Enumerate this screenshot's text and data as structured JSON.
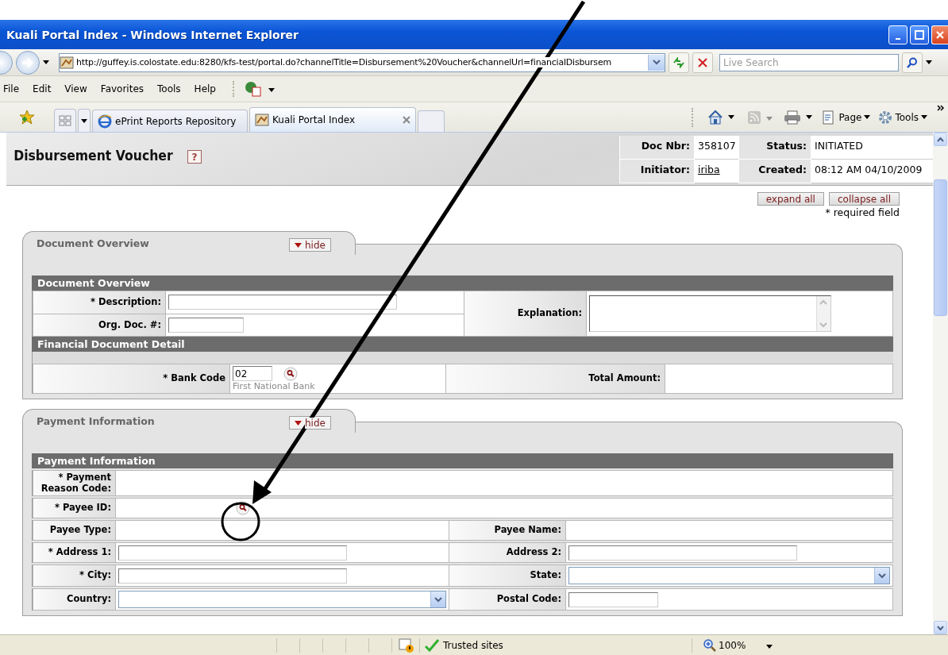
{
  "window": {
    "title": "Kuali Portal Index - Windows Internet Explorer"
  },
  "address_bar": {
    "url": "http://guffey.is.colostate.edu:8280/kfs-test/portal.do?channelTitle=Disbursement%20Voucher&channelUrl=financialDisbursem",
    "search_placeholder": "Live Search"
  },
  "menu": [
    "File",
    "Edit",
    "View",
    "Favorites",
    "Tools",
    "Help"
  ],
  "tabs": [
    {
      "label": "ePrint Reports Repository",
      "selected": false
    },
    {
      "label": "Kuali Portal Index",
      "selected": true
    }
  ],
  "command_bar": [
    "Page",
    "Tools"
  ],
  "page": {
    "title": "Disbursement Voucher",
    "help": "?",
    "doc_info": [
      {
        "label": "Doc Nbr:",
        "value": "358107",
        "kind": "text"
      },
      {
        "label": "Status:",
        "value": "INITIATED",
        "kind": "text"
      },
      {
        "label": "Initiator:",
        "value": "iriba",
        "kind": "link"
      },
      {
        "label": "Created:",
        "value": "08:12 AM 04/10/2009",
        "kind": "text"
      }
    ],
    "buttons": [
      "expand all",
      "collapse all"
    ],
    "required_note": "* required field",
    "sections": [
      {
        "tab_title": "Document Overview",
        "toggle": "hide",
        "subsections": [
          {
            "header": "Document Overview",
            "kind": "overview",
            "fields": [
              {
                "label": "* Description:",
                "kind": "text-long"
              },
              {
                "label": "Org. Doc. #:",
                "kind": "text-short"
              },
              {
                "label": "Explanation:",
                "kind": "textarea"
              }
            ]
          },
          {
            "header": "Financial Document Detail",
            "kind": "detail",
            "fields": [
              {
                "label": "* Bank Code",
                "kind": "text-tiny",
                "value": "02",
                "lookup": true,
                "note": "First National Bank"
              },
              {
                "label": "Total Amount:",
                "kind": "none"
              }
            ]
          }
        ]
      },
      {
        "tab_title": "Payment Information",
        "toggle": "hide",
        "subsections": [
          {
            "header": "Payment Information",
            "kind": "payment",
            "rows": [
              {
                "kind": "wide",
                "fields": [
                  {
                    "label": "* Payment Reason Code:",
                    "kind": "none"
                  }
                ]
              },
              {
                "kind": "wide",
                "fields": [
                  {
                    "label": "* Payee ID:",
                    "kind": "none",
                    "lookup": true
                  }
                ]
              },
              {
                "kind": "pair",
                "fields": [
                  {
                    "label": "Payee Type:",
                    "kind": "none"
                  },
                  {
                    "label": "Payee Name:",
                    "kind": "none"
                  }
                ]
              },
              {
                "kind": "pair",
                "fields": [
                  {
                    "label": "* Address 1:",
                    "kind": "text-long"
                  },
                  {
                    "label": "Address 2:",
                    "kind": "text-long"
                  }
                ]
              },
              {
                "kind": "pair",
                "fields": [
                  {
                    "label": "* City:",
                    "kind": "text-long"
                  },
                  {
                    "label": "State:",
                    "kind": "select"
                  }
                ]
              },
              {
                "kind": "pair",
                "fields": [
                  {
                    "label": "Country:",
                    "kind": "select"
                  },
                  {
                    "label": "Postal Code:",
                    "kind": "text-postal"
                  }
                ]
              }
            ]
          }
        ]
      }
    ]
  },
  "status_bar": {
    "zone": "Trusted sites",
    "zoom": "100%"
  }
}
